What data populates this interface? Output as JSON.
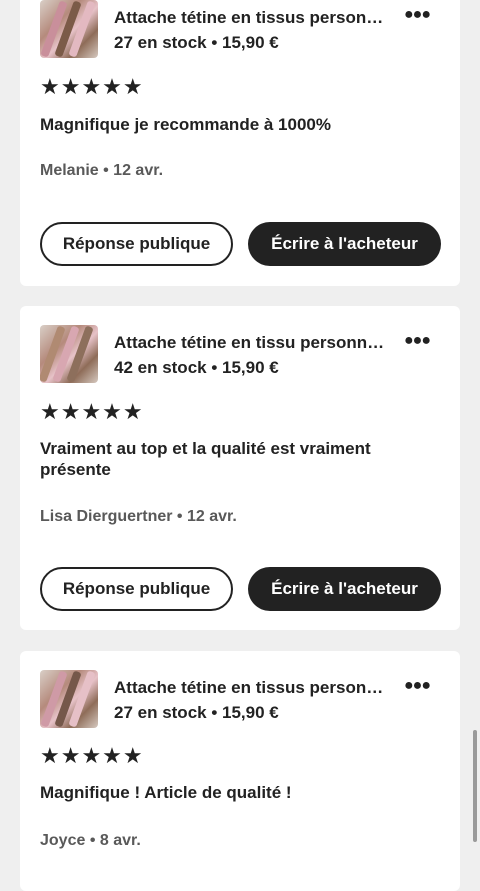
{
  "reviews": [
    {
      "title": "Attache tétine en tissus personnalisée",
      "stock": "27 en stock • 15,90 €",
      "stars": "★★★★★",
      "text": "Magnifique je recommande à 1000%",
      "author": "Melanie • 12 avr.",
      "public_reply": "Réponse publique",
      "write_buyer": "Écrire à l'acheteur"
    },
    {
      "title": "Attache tétine en tissu personnalisée",
      "stock": "42 en stock • 15,90 €",
      "stars": "★★★★★",
      "text": "Vraiment au top et la qualité est vraiment présente",
      "author": "Lisa Dierguertner • 12 avr.",
      "public_reply": "Réponse publique",
      "write_buyer": "Écrire à l'acheteur"
    },
    {
      "title": "Attache tétine en tissus personnalisée",
      "stock": "27 en stock • 15,90 €",
      "stars": "★★★★★",
      "text": "Magnifique ! Article de qualité !",
      "author": "Joyce • 8 avr."
    }
  ],
  "icons": {
    "more": "more-horizontal-icon",
    "star": "star-icon"
  },
  "colors": {
    "background": "#efefef",
    "card": "#ffffff",
    "text": "#222222",
    "muted": "#595959",
    "button_dark": "#222222"
  }
}
